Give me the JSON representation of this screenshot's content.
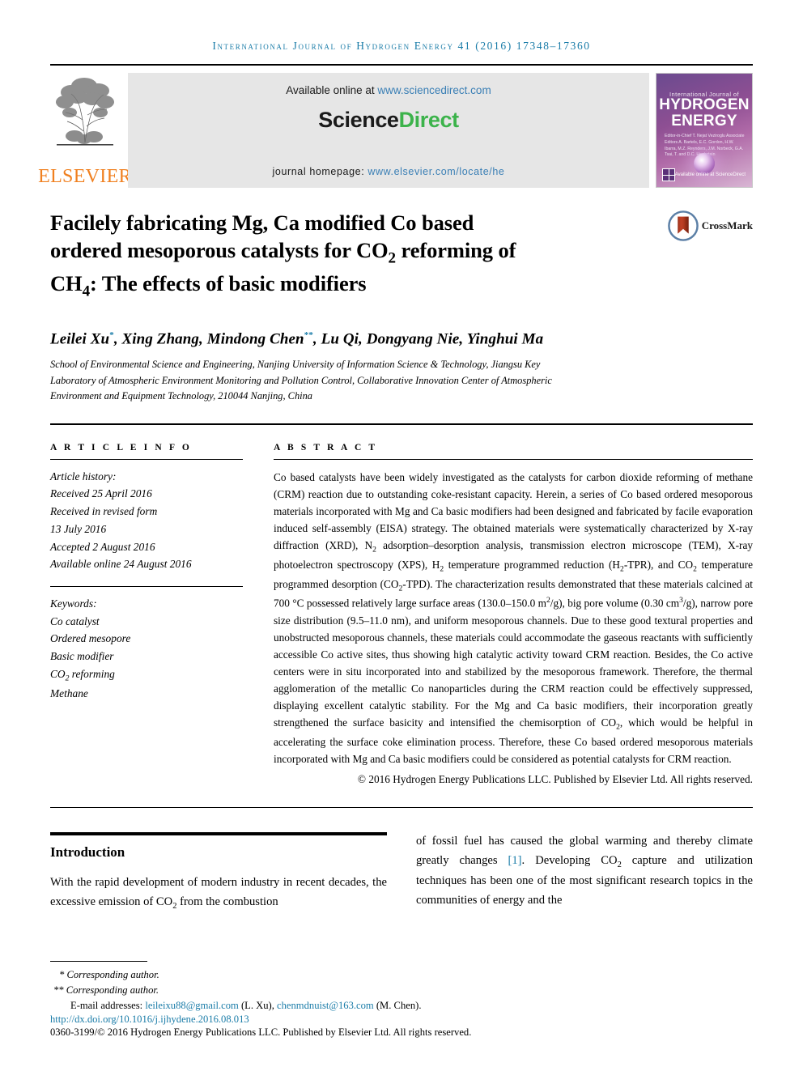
{
  "running_head": "International Journal of Hydrogen Energy 41 (2016) 17348–17360",
  "masthead": {
    "publisher_name": "ELSEVIER",
    "available_prefix": "Available online at ",
    "available_url": "www.sciencedirect.com",
    "sciencedirect_part1": "Science",
    "sciencedirect_part2": "Direct",
    "homepage_label": "journal homepage: ",
    "homepage_url": "www.elsevier.com/locate/he",
    "cover": {
      "top_line": "International Journal of",
      "title_line1": "HYDROGEN",
      "title_line2": "ENERGY",
      "editors": "Editor-in-Chief  T. Nejat Veziroglu\nAssociate Editors  A. Bartels, E.C. Gordon, H.W. Ibarra,\nM.Z. Reynders, J.M. Norbeck,\nG.A. Tsai, T. and D.C. Hochstein",
      "sciencedirect_label": "Available online at\nScienceDirect"
    }
  },
  "article": {
    "title_line1": "Facilely fabricating Mg, Ca modified Co based",
    "title_line2_a": "ordered mesoporous catalysts for CO",
    "title_line2_sub": "2",
    "title_line2_b": " reforming of",
    "title_line3_a": "CH",
    "title_line3_sub": "4",
    "title_line3_b": ": The effects of basic modifiers",
    "crossmark_label": "CrossMark",
    "authors": "Leilei Xu *, Xing Zhang, Mindong Chen **, Lu Qi, Dongyang Nie, Yinghui Ma",
    "affiliation": "School of Environmental Science and Engineering, Nanjing University of Information Science & Technology, Jiangsu Key Laboratory of Atmospheric Environment Monitoring and Pollution Control, Collaborative Innovation Center of Atmospheric Environment and Equipment Technology, 210044 Nanjing, China"
  },
  "article_info": {
    "heading": "A R T I C L E   I N F O",
    "history_label": "Article history:",
    "history": [
      "Received 25 April 2016",
      "Received in revised form",
      "13 July 2016",
      "Accepted 2 August 2016",
      "Available online 24 August 2016"
    ],
    "keywords_label": "Keywords:",
    "keywords": [
      "Co catalyst",
      "Ordered mesopore",
      "Basic modifier",
      "CO2 reforming",
      "Methane"
    ]
  },
  "abstract": {
    "heading": "A B S T R A C T",
    "text": "Co based catalysts have been widely investigated as the catalysts for carbon dioxide reforming of methane (CRM) reaction due to outstanding coke-resistant capacity. Herein, a series of Co based ordered mesoporous materials incorporated with Mg and Ca basic modifiers had been designed and fabricated by facile evaporation induced self-assembly (EISA) strategy. The obtained materials were systematically characterized by X-ray diffraction (XRD), N2 adsorption–desorption analysis, transmission electron microscope (TEM), X-ray photoelectron spectroscopy (XPS), H2 temperature programmed reduction (H2-TPR), and CO2 temperature programmed desorption (CO2-TPD). The characterization results demonstrated that these materials calcined at 700 °C possessed relatively large surface areas (130.0–150.0 m2/g), big pore volume (0.30 cm3/g), narrow pore size distribution (9.5–11.0 nm), and uniform mesoporous channels. Due to these good textural properties and unobstructed mesoporous channels, these materials could accommodate the gaseous reactants with sufficiently accessible Co active sites, thus showing high catalytic activity toward CRM reaction. Besides, the Co active centers were in situ incorporated into and stabilized by the mesoporous framework. Therefore, the thermal agglomeration of the metallic Co nanoparticles during the CRM reaction could be effectively suppressed, displaying excellent catalytic stability. For the Mg and Ca basic modifiers, their incorporation greatly strengthened the surface basicity and intensified the chemisorption of CO2, which would be helpful in accelerating the surface coke elimination process. Therefore, these Co based ordered mesoporous materials incorporated with Mg and Ca basic modifiers could be considered as potential catalysts for CRM reaction.",
    "copyright": "© 2016 Hydrogen Energy Publications LLC. Published by Elsevier Ltd. All rights reserved."
  },
  "body": {
    "intro_heading": "Introduction",
    "left_paragraph": "With the rapid development of modern industry in recent decades, the excessive emission of CO2 from the combustion",
    "right_paragraph_a": "of fossil fuel has caused the global warming and thereby climate greatly changes ",
    "right_reference": "[1]",
    "right_paragraph_b": ". Developing CO2 capture and utilization techniques has been one of the most significant research topics in the communities of energy and the"
  },
  "footnotes": {
    "corresponding1": "* Corresponding author.",
    "corresponding2": "** Corresponding author.",
    "email_label": "E-mail addresses: ",
    "email1": "leileixu88@gmail.com",
    "email1_attr": " (L. Xu), ",
    "email2": "chenmdnuist@163.com",
    "email2_attr": " (M. Chen).",
    "doi": "http://dx.doi.org/10.1016/j.ijhydene.2016.08.013",
    "issn_line": "0360-3199/© 2016 Hydrogen Energy Publications LLC. Published by Elsevier Ltd. All rights reserved."
  },
  "colors": {
    "link": "#1a7ca8",
    "sciencedirect_green": "#3cb34b",
    "elsevier_orange": "#f08020"
  }
}
